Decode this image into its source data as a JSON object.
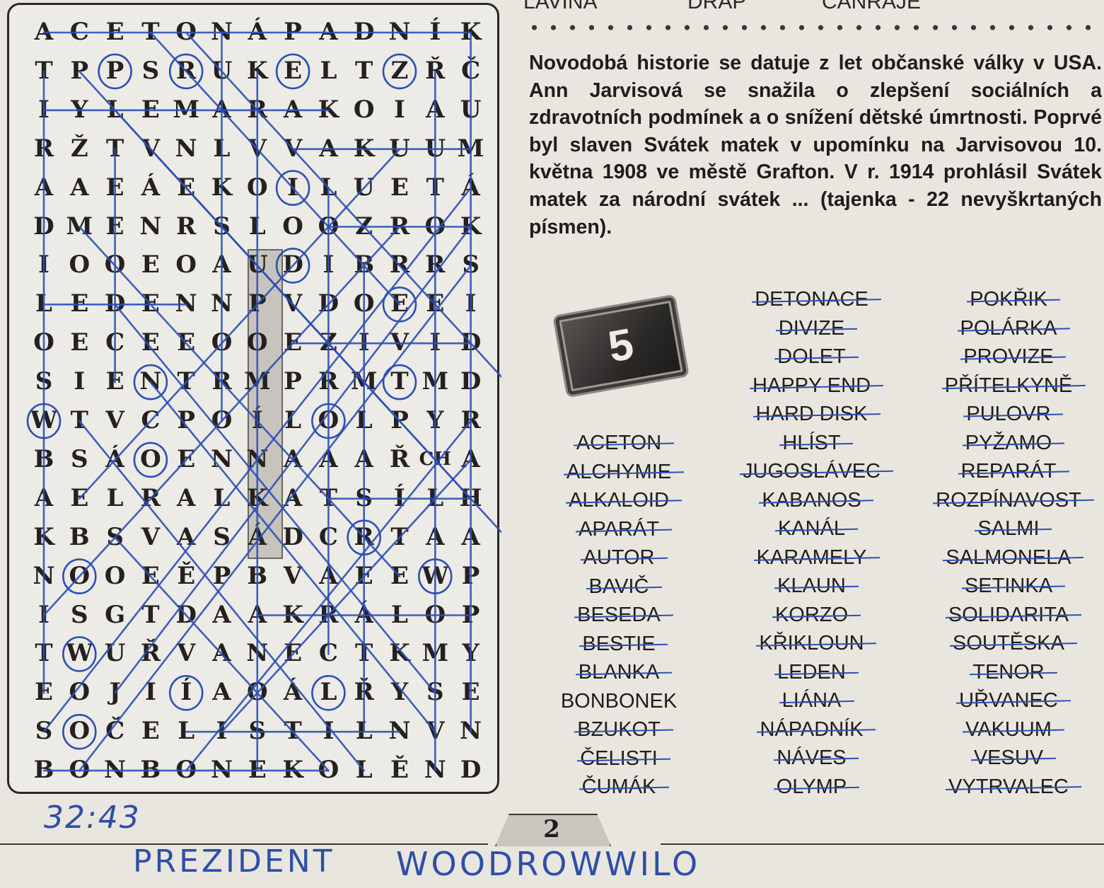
{
  "top_words": [
    "LAVINA",
    "DRAP",
    "CANRAJE"
  ],
  "grid": {
    "rows": [
      [
        "A",
        "C",
        "E",
        "T",
        "O",
        "N",
        "Á",
        "P",
        "A",
        "D",
        "N",
        "Í",
        "K"
      ],
      [
        "T",
        "P",
        "P",
        "S",
        "R",
        "U",
        "K",
        "E",
        "L",
        "T",
        "Z",
        "Ř",
        "Č"
      ],
      [
        "I",
        "Y",
        "L",
        "E",
        "M",
        "A",
        "R",
        "A",
        "K",
        "O",
        "I",
        "A",
        "U"
      ],
      [
        "R",
        "Ž",
        "T",
        "V",
        "N",
        "L",
        "V",
        "V",
        "A",
        "K",
        "U",
        "U",
        "M"
      ],
      [
        "A",
        "A",
        "E",
        "Á",
        "E",
        "K",
        "O",
        "I",
        "L",
        "U",
        "E",
        "T",
        "Á"
      ],
      [
        "D",
        "M",
        "E",
        "N",
        "R",
        "S",
        "L",
        "O",
        "O",
        "Z",
        "R",
        "O",
        "K"
      ],
      [
        "I",
        "O",
        "O",
        "E",
        "O",
        "A",
        "U",
        "D",
        "I",
        "B",
        "R",
        "R",
        "S"
      ],
      [
        "L",
        "E",
        "D",
        "E",
        "N",
        "N",
        "P",
        "V",
        "D",
        "O",
        "E",
        "E",
        "I"
      ],
      [
        "O",
        "E",
        "C",
        "E",
        "E",
        "O",
        "O",
        "E",
        "Z",
        "I",
        "V",
        "I",
        "D"
      ],
      [
        "S",
        "I",
        "E",
        "N",
        "T",
        "R",
        "M",
        "P",
        "R",
        "M",
        "T",
        "M",
        "D"
      ],
      [
        "W",
        "T",
        "V",
        "C",
        "P",
        "O",
        "Í",
        "L",
        "O",
        "L",
        "P",
        "Y",
        "R"
      ],
      [
        "B",
        "S",
        "Á",
        "O",
        "E",
        "N",
        "N",
        "A",
        "A",
        "A",
        "Ř",
        "CH",
        "A"
      ],
      [
        "A",
        "E",
        "L",
        "R",
        "A",
        "L",
        "K",
        "A",
        "T",
        "S",
        "Í",
        "L",
        "H"
      ],
      [
        "K",
        "B",
        "S",
        "V",
        "A",
        "S",
        "Á",
        "D",
        "C",
        "R",
        "T",
        "A",
        "A"
      ],
      [
        "N",
        "O",
        "O",
        "E",
        "Ě",
        "P",
        "B",
        "V",
        "A",
        "E",
        "E",
        "W",
        "P"
      ],
      [
        "I",
        "S",
        "G",
        "T",
        "D",
        "A",
        "A",
        "K",
        "R",
        "Á",
        "L",
        "O",
        "P"
      ],
      [
        "T",
        "W",
        "U",
        "Ř",
        "V",
        "A",
        "N",
        "E",
        "C",
        "T",
        "K",
        "M",
        "Y"
      ],
      [
        "E",
        "O",
        "J",
        "I",
        "Í",
        "A",
        "O",
        "Á",
        "L",
        "Ř",
        "Y",
        "S",
        "E"
      ],
      [
        "S",
        "O",
        "Č",
        "E",
        "L",
        "I",
        "S",
        "T",
        "I",
        "L",
        "N",
        "V",
        "N"
      ],
      [
        "B",
        "O",
        "N",
        "B",
        "O",
        "N",
        "E",
        "K",
        "O",
        "L",
        "Ě",
        "N",
        "D"
      ]
    ]
  },
  "puzzle_number": "5",
  "intro_text": "Novodobá historie se datuje z let občanské války v USA. Ann Jarvisová se snažila o zlepšení sociálních a zdravotních podmínek a o snížení dětské úmrtnosti. Poprvé byl slaven Svátek matek v upomínku na Jarvisovou 10. května 1908 ve městě Grafton. V r. 1914 prohlásil Svátek matek za národní svátek ... (tajenka - 22 nevyškrtaných písmen).",
  "word_list": {
    "column1": [
      {
        "word": "ACETON",
        "struck": true
      },
      {
        "word": "ALCHYMIE",
        "struck": true
      },
      {
        "word": "ALKALOID",
        "struck": true
      },
      {
        "word": "APARÁT",
        "struck": true
      },
      {
        "word": "AUTOR",
        "struck": true
      },
      {
        "word": "BAVIČ",
        "struck": true
      },
      {
        "word": "BESEDA",
        "struck": true
      },
      {
        "word": "BESTIE",
        "struck": true
      },
      {
        "word": "BLANKA",
        "struck": true
      },
      {
        "word": "BONBONEK",
        "struck": false
      },
      {
        "word": "BZUKOT",
        "struck": true
      },
      {
        "word": "ČELISTI",
        "struck": true
      },
      {
        "word": "ČUMÁK",
        "struck": true
      }
    ],
    "column2": [
      {
        "word": "DETONACE",
        "struck": true
      },
      {
        "word": "DIVIZE",
        "struck": true
      },
      {
        "word": "DOLET",
        "struck": true
      },
      {
        "word": "HAPPY END",
        "struck": true
      },
      {
        "word": "HARD DISK",
        "struck": true
      },
      {
        "word": "HLÍST",
        "struck": true
      },
      {
        "word": "JUGOSLÁVEC",
        "struck": true
      },
      {
        "word": "KABANOS",
        "struck": true
      },
      {
        "word": "KANÁL",
        "struck": true
      },
      {
        "word": "KARAMELY",
        "struck": true
      },
      {
        "word": "KLAUN",
        "struck": true
      },
      {
        "word": "KORZO",
        "struck": true
      },
      {
        "word": "KŘIKLOUN",
        "struck": true
      },
      {
        "word": "LEDEN",
        "struck": true
      },
      {
        "word": "LIÁNA",
        "struck": true
      },
      {
        "word": "NÁPADNÍK",
        "struck": true
      },
      {
        "word": "NÁVES",
        "struck": true
      },
      {
        "word": "OLYMP",
        "struck": true
      }
    ],
    "column3": [
      {
        "word": "POKŘIK",
        "struck": true
      },
      {
        "word": "POLÁRKA",
        "struck": true
      },
      {
        "word": "PROVIZE",
        "struck": true
      },
      {
        "word": "PŘÍTELKYNĚ",
        "struck": true
      },
      {
        "word": "PULOVR",
        "struck": true
      },
      {
        "word": "PYŽAMO",
        "struck": true
      },
      {
        "word": "REPARÁT",
        "struck": true
      },
      {
        "word": "ROZPÍNAVOST",
        "struck": true
      },
      {
        "word": "SALMI",
        "struck": true
      },
      {
        "word": "SALMONELA",
        "struck": true
      },
      {
        "word": "SETINKA",
        "struck": true
      },
      {
        "word": "SOLIDARITA",
        "struck": true
      },
      {
        "word": "SOUTĚSKA",
        "struck": true
      },
      {
        "word": "TENOR",
        "struck": true
      },
      {
        "word": "UŘVANEC",
        "struck": true
      },
      {
        "word": "VAKUUM",
        "struck": true
      },
      {
        "word": "VESUV",
        "struck": true
      },
      {
        "word": "VYTRVALEC",
        "struck": true
      }
    ]
  },
  "page_number": "2",
  "handwritten": {
    "time": "32:43",
    "answer_part1": "PREZIDENT",
    "answer_part2": "WOODROWWILO"
  },
  "colors": {
    "pen": "#2e4fb5",
    "highlight": "#c7c4bd",
    "paper": "#e9e6df"
  }
}
